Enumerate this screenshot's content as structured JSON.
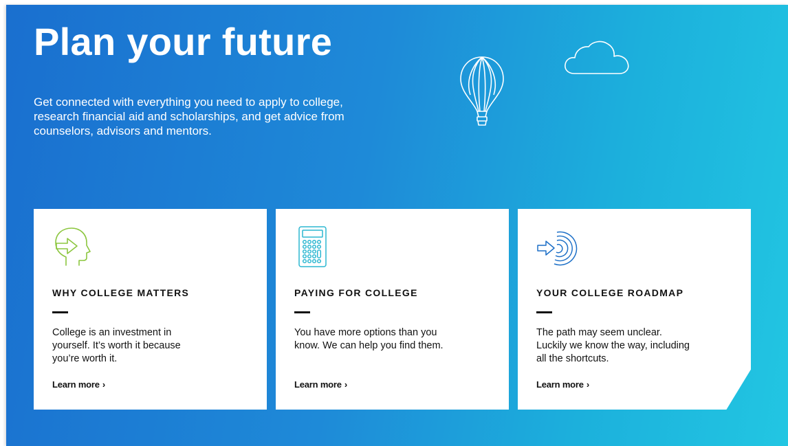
{
  "hero": {
    "title": "Plan your future",
    "subtitle": "Get connected with everything you need to apply to college, research financial aid and scholarships, and get advice from counselors, advisors and mentors.",
    "decorations": [
      "hot-air-balloon-icon",
      "cloud-icon"
    ]
  },
  "cards": [
    {
      "icon": "head-arrow-icon",
      "icon_color": "#8cc63f",
      "title": "WHY COLLEGE MATTERS",
      "text": "College is an investment in yourself. It’s worth it because you’re worth it.",
      "link": "Learn more",
      "link_chevron": "›"
    },
    {
      "icon": "calculator-icon",
      "icon_color": "#2bb7d1",
      "title": "PAYING FOR COLLEGE",
      "text": "You have more options than you know. We can help you find them.",
      "link": "Learn more",
      "link_chevron": "›"
    },
    {
      "icon": "arrow-target-icon",
      "icon_color": "#1c6fc7",
      "title": "YOUR COLLEGE ROADMAP",
      "text": "The path may seem unclear. Luckily we know the way, including all the shortcuts.",
      "link": "Learn more",
      "link_chevron": "›"
    }
  ],
  "colors": {
    "gradient_start": "#1a6fcf",
    "gradient_end": "#22c6e2",
    "card_background": "#ffffff",
    "text": "#111111"
  }
}
